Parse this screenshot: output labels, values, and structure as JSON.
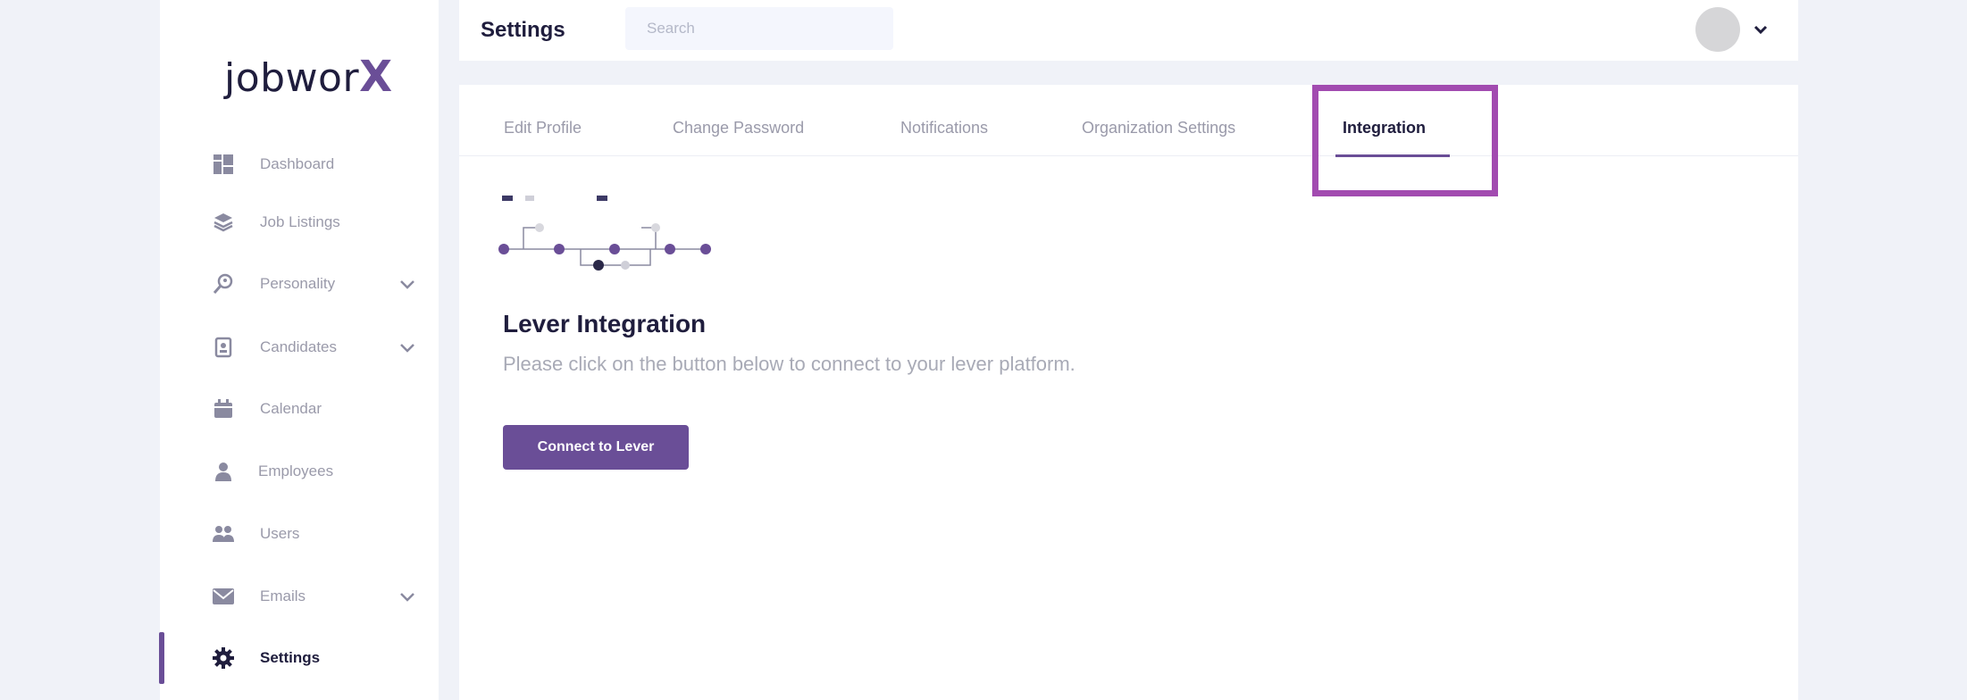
{
  "app": {
    "logo_text": "jobwor",
    "logo_accent": "X"
  },
  "sidebar": {
    "items": [
      {
        "label": "Dashboard",
        "icon": "dashboard-icon"
      },
      {
        "label": "Job Listings",
        "icon": "layers-icon"
      },
      {
        "label": "Personality",
        "icon": "search-person-icon",
        "has_submenu": true
      },
      {
        "label": "Candidates",
        "icon": "candidate-card-icon",
        "has_submenu": true
      },
      {
        "label": "Calendar",
        "icon": "calendar-icon"
      },
      {
        "label": "Employees",
        "icon": "employee-icon"
      },
      {
        "label": "Users",
        "icon": "users-icon"
      },
      {
        "label": "Emails",
        "icon": "mail-icon",
        "has_submenu": true
      },
      {
        "label": "Settings",
        "icon": "gear-icon",
        "active": true
      }
    ]
  },
  "header": {
    "title": "Settings",
    "search": {
      "placeholder": "Search",
      "value": ""
    }
  },
  "tabs": [
    {
      "label": "Edit Profile"
    },
    {
      "label": "Change Password"
    },
    {
      "label": "Notifications"
    },
    {
      "label": "Organization Settings"
    },
    {
      "label": "Integration",
      "active": true
    }
  ],
  "integration": {
    "title": "Lever Integration",
    "description": "Please click on the button below to connect to your lever platform.",
    "button_label": "Connect to Lever"
  },
  "colors": {
    "accent": "#6a4e97",
    "highlight": "#a24bb0",
    "text_dark": "#1f1d3d",
    "text_muted": "#9a9aaa",
    "background": "#f0f2f8"
  }
}
